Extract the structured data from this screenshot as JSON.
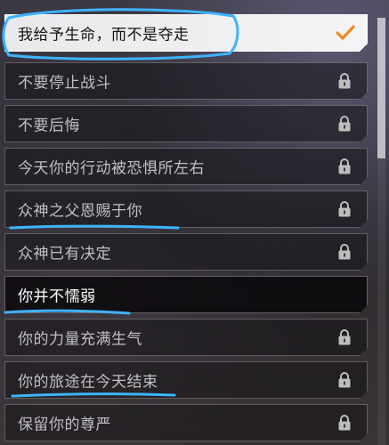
{
  "options": [
    {
      "label": "我给予生命，而不是夺走",
      "state": "selected",
      "icon": "check-icon"
    },
    {
      "label": "不要停止战斗",
      "state": "locked",
      "icon": "lock-icon"
    },
    {
      "label": "不要后悔",
      "state": "locked",
      "icon": "lock-icon"
    },
    {
      "label": "今天你的行动被恐惧所左右",
      "state": "locked",
      "icon": "lock-icon"
    },
    {
      "label": "众神之父恩赐于你",
      "state": "locked",
      "icon": "lock-icon"
    },
    {
      "label": "众神已有决定",
      "state": "locked",
      "icon": "lock-icon"
    },
    {
      "label": "你并不懦弱",
      "state": "unlocked",
      "icon": ""
    },
    {
      "label": "你的力量充满生气",
      "state": "locked",
      "icon": "lock-icon"
    },
    {
      "label": "你的旅途在今天结束",
      "state": "locked",
      "icon": "lock-icon"
    },
    {
      "label": "保留你的尊严",
      "state": "locked",
      "icon": "lock-icon"
    }
  ],
  "colors": {
    "check": "#f08a1c",
    "highlight_marker": "#3fb3ff",
    "lock": "#bdbdbd"
  }
}
